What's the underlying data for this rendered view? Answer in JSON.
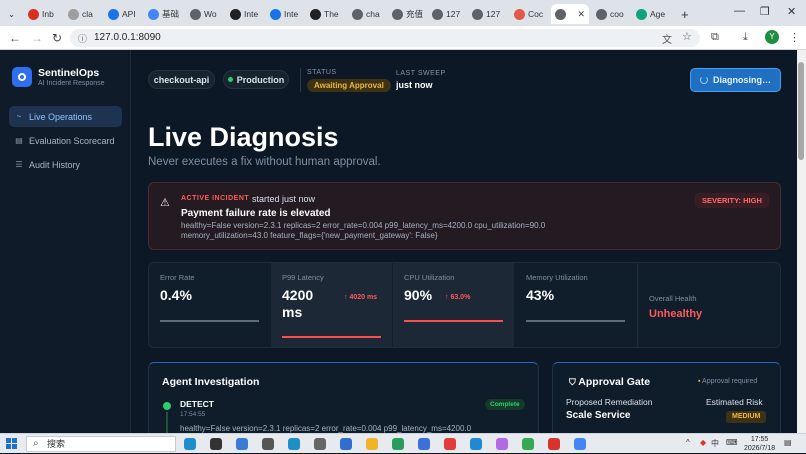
{
  "browser": {
    "tabs": [
      {
        "label": "Inb",
        "color": "#d93025"
      },
      {
        "label": "cla",
        "color": "#9e9e9e"
      },
      {
        "label": "API",
        "color": "#1a73e8"
      },
      {
        "label": "基础",
        "color": "#4285f4"
      },
      {
        "label": "Wo",
        "color": "#5f6368"
      },
      {
        "label": "Inte",
        "color": "#202124"
      },
      {
        "label": "Inte",
        "color": "#1a73e8"
      },
      {
        "label": "The",
        "color": "#202124"
      },
      {
        "label": "cha",
        "color": "#5f6368"
      },
      {
        "label": "充值",
        "color": "#5f6368"
      },
      {
        "label": "127",
        "color": "#5f6368"
      },
      {
        "label": "127",
        "color": "#5f6368"
      },
      {
        "label": "Coc",
        "color": "#e05a47"
      },
      {
        "label": "",
        "color": "#5f6368"
      },
      {
        "label": "coo",
        "color": "#5f6368"
      },
      {
        "label": "Age",
        "color": "#10a37f"
      }
    ],
    "new_tab": "+",
    "win_minimize": "—",
    "win_maximize": "❐",
    "win_close": "✕",
    "tab_close": "✕",
    "tab_menu": "⌄",
    "url": "127.0.0.1:8090",
    "profile_initial": "Y"
  },
  "app": {
    "brand": "SentinelOps",
    "brand_subtitle": "AI Incident Response",
    "nav": [
      {
        "icon": "~",
        "label": "Live Operations"
      },
      {
        "icon": "▤",
        "label": "Evaluation Scorecard"
      },
      {
        "icon": "☰",
        "label": "Audit History"
      }
    ]
  },
  "header": {
    "service": "checkout-api",
    "environment": "Production",
    "status_label": "STATUS",
    "status_value": "Awaiting Approval",
    "sweep_label": "LAST SWEEP",
    "sweep_value": "just now",
    "diagnose_button": "Diagnosing…"
  },
  "page": {
    "title": "Live Diagnosis",
    "subtitle": "Never executes a fix without human approval."
  },
  "incident": {
    "tag": "ACTIVE INCIDENT",
    "started": "started just now",
    "title": "Payment failure rate is elevated",
    "detail_line1": "healthy=False version=2.3.1 replicas=2 error_rate=0.004 p99_latency_ms=4200.0 cpu_utilization=90.0",
    "detail_line2": "memory_utilization=43.0 feature_flags={'new_payment_gateway': False}",
    "severity": "SEVERITY: HIGH"
  },
  "metrics": [
    {
      "label": "Error Rate",
      "value": "0.4%",
      "delta": "",
      "fill": 1.0,
      "color": "#5f6b78"
    },
    {
      "label": "P99 Latency",
      "value": "4200 ms",
      "delta": "↑ 4020 ms",
      "fill": 1.0,
      "color": "#ff4d4d"
    },
    {
      "label": "CPU Utilization",
      "value": "90%",
      "delta": "↑ 63.0%",
      "fill": 1.0,
      "color": "#ff4d4d"
    },
    {
      "label": "Memory Utilization",
      "value": "43%",
      "delta": "",
      "fill": 1.0,
      "color": "#5f6b78"
    }
  ],
  "health": {
    "label": "Overall Health",
    "value": "Unhealthy"
  },
  "investigation": {
    "title": "Agent Investigation",
    "step_title": "DETECT",
    "step_time": "17:54:55",
    "step_status": "Complete",
    "step_detail": "healthy=False version=2.3.1 replicas=2 error_rate=0.004 p99_latency_ms=4200.0"
  },
  "approval": {
    "title": "Approval Gate",
    "required": "Approval required",
    "remediation_label": "Proposed Remediation",
    "remediation_value": "Scale Service",
    "risk_label": "Estimated Risk",
    "risk_value": "MEDIUM"
  },
  "taskbar": {
    "search_placeholder": "搜索",
    "time": "17:55",
    "date": "2026/7/18",
    "ime": "中",
    "tray_chevron": "^",
    "icons": [
      {
        "name": "edge",
        "color": "#1f8ecf"
      },
      {
        "name": "app",
        "color": "#333333"
      },
      {
        "name": "app",
        "color": "#3a7bd5"
      },
      {
        "name": "app",
        "color": "#555555"
      },
      {
        "name": "app",
        "color": "#1e90c8"
      },
      {
        "name": "app",
        "color": "#666666"
      },
      {
        "name": "calendar",
        "color": "#2f6fd0"
      },
      {
        "name": "folder",
        "color": "#f0b429"
      },
      {
        "name": "app",
        "color": "#2a9d5c"
      },
      {
        "name": "app",
        "color": "#3d6fd8"
      },
      {
        "name": "app",
        "color": "#e23c3c"
      },
      {
        "name": "vscode",
        "color": "#1f8ad2"
      },
      {
        "name": "app",
        "color": "#b36ae2"
      },
      {
        "name": "chrome",
        "color": "#34a853"
      },
      {
        "name": "wps",
        "color": "#d9342b"
      },
      {
        "name": "chrome-alt",
        "color": "#4285f4"
      }
    ]
  }
}
